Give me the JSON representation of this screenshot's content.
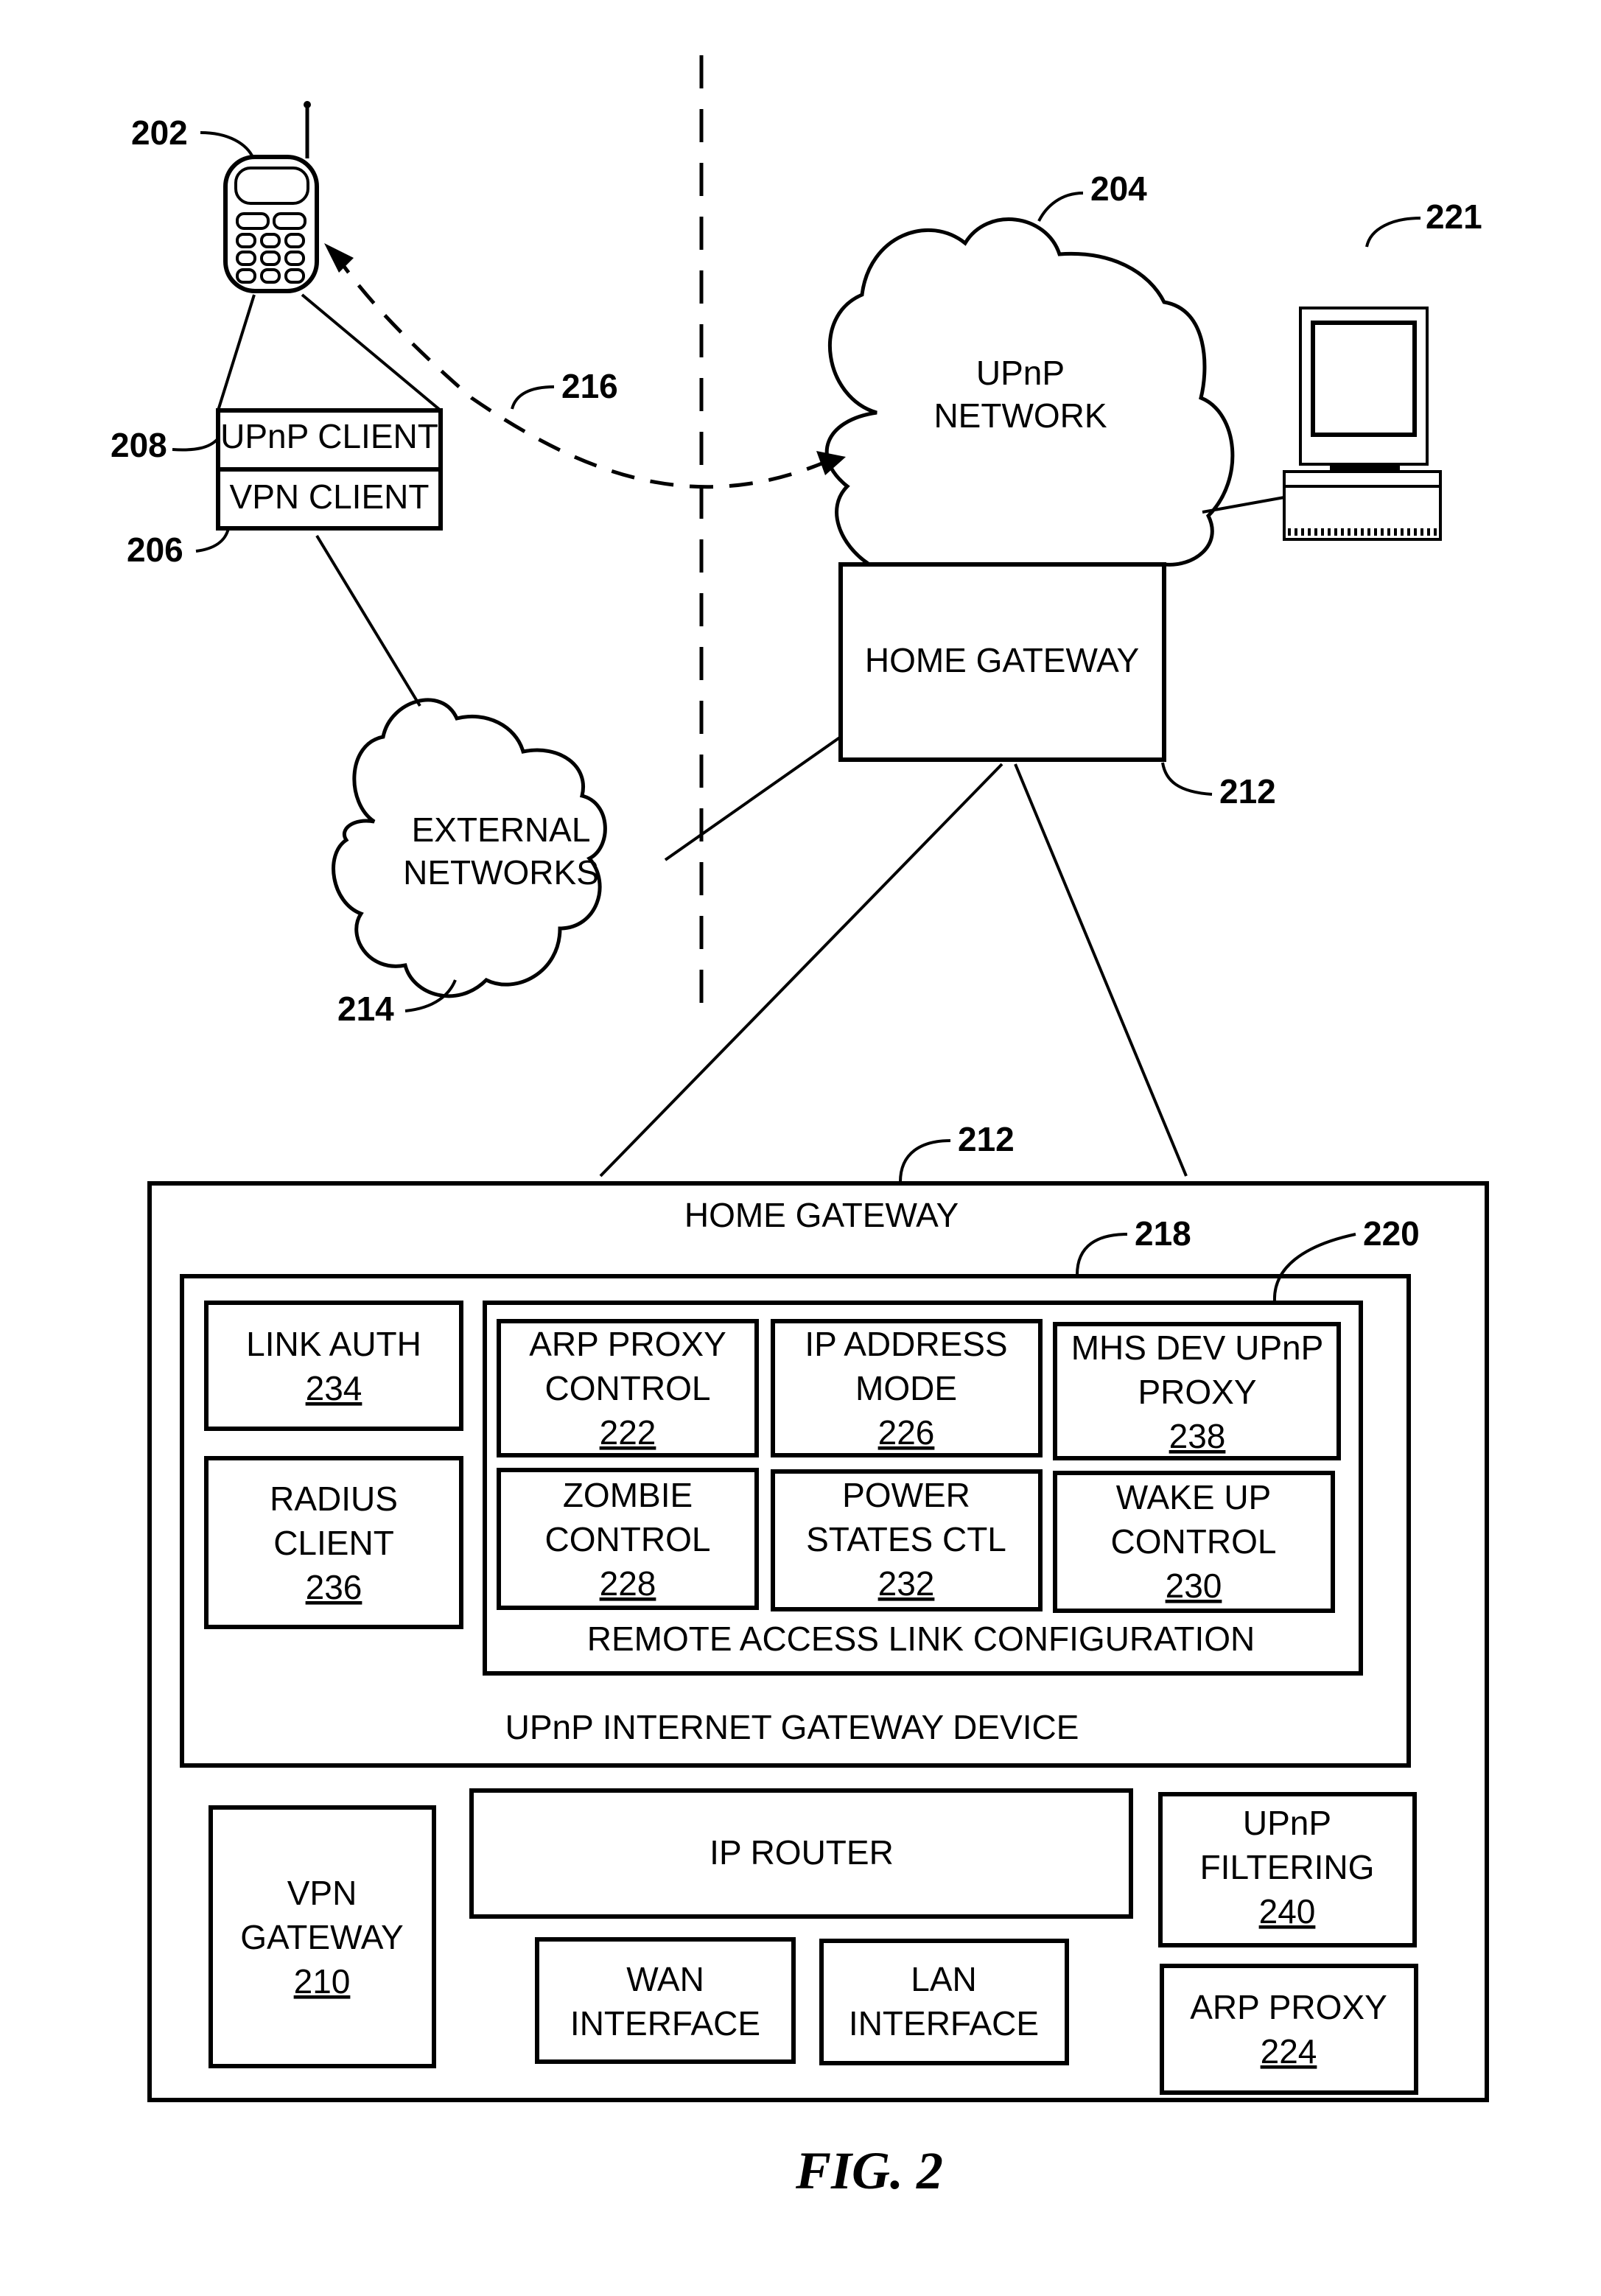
{
  "figure_label": "FIG. 2",
  "refs": {
    "phone": "202",
    "upnp_network": "204",
    "client_stack_vpn": "206",
    "client_stack_upnp": "208",
    "home_gateway": "212",
    "home_gateway_detail": "212",
    "external_networks": "214",
    "upnp_path": "216",
    "igd": "218",
    "remote_access": "220",
    "computer": "221"
  },
  "phone_stack": {
    "upnp_client": "UPnP CLIENT",
    "vpn_client": "VPN CLIENT"
  },
  "clouds": {
    "upnp_network": [
      "UPnP",
      "NETWORK"
    ],
    "external_networks": [
      "EXTERNAL",
      "NETWORKS"
    ]
  },
  "home_gateway_small": "HOME GATEWAY",
  "detail": {
    "title": "HOME GATEWAY",
    "igd_label": "UPnP INTERNET GATEWAY DEVICE",
    "remote_access_label": "REMOTE ACCESS LINK CONFIGURATION",
    "link_auth": {
      "lines": [
        "LINK AUTH"
      ],
      "num": "234"
    },
    "radius_client": {
      "lines": [
        "RADIUS",
        "CLIENT"
      ],
      "num": "236"
    },
    "arp_proxy_control": {
      "lines": [
        "ARP PROXY",
        "CONTROL"
      ],
      "num": "222"
    },
    "ip_address_mode": {
      "lines": [
        "IP ADDRESS",
        "MODE"
      ],
      "num": "226"
    },
    "mhs_dev_upnp_proxy": {
      "lines": [
        "MHS DEV UPnP",
        "PROXY"
      ],
      "num": "238"
    },
    "zombie_control": {
      "lines": [
        "ZOMBIE",
        "CONTROL"
      ],
      "num": "228"
    },
    "power_states_ctl": {
      "lines": [
        "POWER",
        "STATES CTL"
      ],
      "num": "232"
    },
    "wake_up_control": {
      "lines": [
        "WAKE UP",
        "CONTROL"
      ],
      "num": "230"
    },
    "vpn_gateway": {
      "lines": [
        "VPN",
        "GATEWAY"
      ],
      "num": "210"
    },
    "ip_router": {
      "lines": [
        "IP ROUTER"
      ]
    },
    "wan_interface": {
      "lines": [
        "WAN",
        "INTERFACE"
      ]
    },
    "lan_interface": {
      "lines": [
        "LAN",
        "INTERFACE"
      ]
    },
    "upnp_filtering": {
      "lines": [
        "UPnP",
        "FILTERING"
      ],
      "num": "240"
    },
    "arp_proxy": {
      "lines": [
        "ARP PROXY"
      ],
      "num": "224"
    }
  }
}
